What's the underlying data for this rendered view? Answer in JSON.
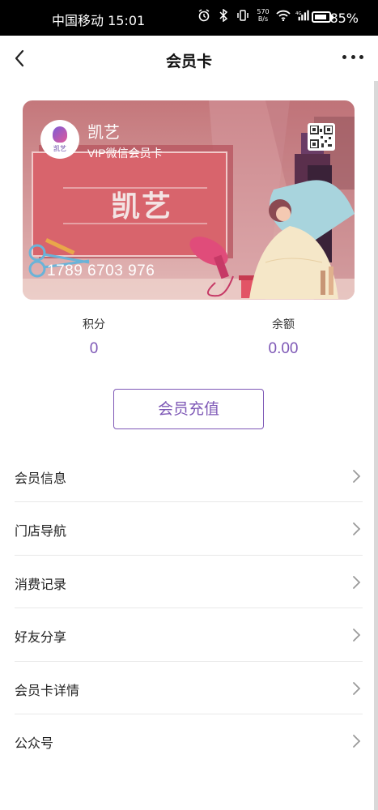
{
  "status_bar": {
    "carrier_time": "中国移动 15:01",
    "net_speed_value": "570",
    "net_speed_unit": "B/s",
    "battery_percent": "85%",
    "battery_level": 0.85
  },
  "nav": {
    "title": "会员卡"
  },
  "card": {
    "logo_text": "凯艺",
    "name": "凯艺",
    "subtitle": "VIP微信会员卡",
    "big_title": "凯艺",
    "number": "1789 6703 976",
    "colors": {
      "base": "#c97a80",
      "panel": "#d2606a",
      "accent": "#e04c7a"
    }
  },
  "stats": {
    "points_label": "积分",
    "points_value": "0",
    "balance_label": "余额",
    "balance_value": "0.00"
  },
  "recharge_label": "会员充值",
  "accent_color": "#7e58b6",
  "menu": [
    {
      "label": "会员信息"
    },
    {
      "label": "门店导航"
    },
    {
      "label": "消费记录"
    },
    {
      "label": "好友分享"
    },
    {
      "label": "会员卡详情"
    },
    {
      "label": "公众号"
    }
  ]
}
